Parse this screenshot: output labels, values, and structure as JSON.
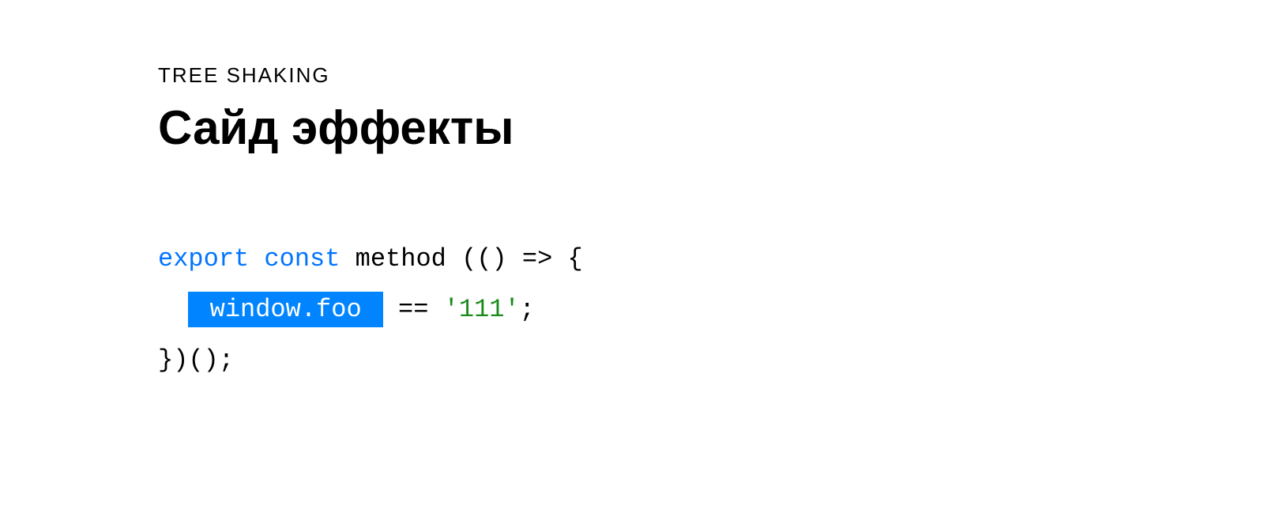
{
  "eyebrow": "TREE SHAKING",
  "title": "Сайд эффекты",
  "code": {
    "line1_kw": "export const",
    "line1_rest": " method (() => {",
    "line2_indent": "  ",
    "line2_highlight": " window.foo ",
    "line2_op": " == ",
    "line2_str": "'111'",
    "line2_end": ";",
    "line3": "})();"
  }
}
